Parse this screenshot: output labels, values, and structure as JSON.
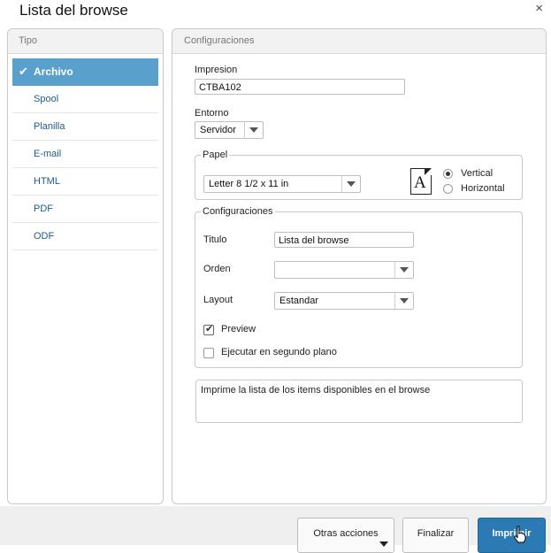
{
  "window": {
    "title": "Lista del browse",
    "close_glyph": "×"
  },
  "left_panel": {
    "header": "Tipo",
    "items": [
      {
        "label": "Archivo",
        "selected": true
      },
      {
        "label": "Spool",
        "selected": false
      },
      {
        "label": "Planilla",
        "selected": false
      },
      {
        "label": "E-mail",
        "selected": false
      },
      {
        "label": "HTML",
        "selected": false
      },
      {
        "label": "PDF",
        "selected": false
      },
      {
        "label": "ODF",
        "selected": false
      }
    ]
  },
  "right_panel": {
    "header": "Configuraciones",
    "impresion": {
      "label": "Impresion",
      "value": "CTBA102"
    },
    "entorno": {
      "label": "Entorno",
      "value": "Servidor"
    },
    "papel": {
      "legend": "Papel",
      "size_value": "Letter 8 1/2 x 11 in",
      "icon_letter": "A",
      "orientation": [
        {
          "label": "Vertical",
          "checked": true
        },
        {
          "label": "Horizontal",
          "checked": false
        }
      ]
    },
    "config": {
      "legend": "Configuraciones",
      "titulo_label": "Titulo",
      "titulo_value": "Lista del browse",
      "orden_label": "Orden",
      "orden_value": "",
      "layout_label": "Layout",
      "layout_value": "Estandar",
      "preview": {
        "label": "Preview",
        "checked": true
      },
      "segundo_plano": {
        "label": "Ejecutar en segundo plano",
        "checked": false
      }
    },
    "description": "Imprime la lista de los items disponibles en el browse"
  },
  "footer": {
    "otras_acciones": "Otras acciones",
    "finalizar": "Finalizar",
    "imprimir": "Imprimir"
  },
  "colors": {
    "selected_item_bg": "#5aa0cc",
    "primary_button": "#2b7ab3",
    "link_text": "#1d5b86"
  }
}
